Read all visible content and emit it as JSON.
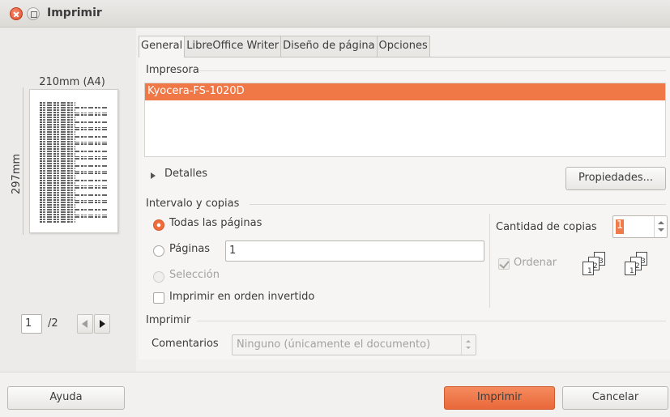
{
  "window": {
    "title": "Imprimir"
  },
  "preview": {
    "width_label": "210mm (A4)",
    "height_label": "297mm",
    "current_page": "1",
    "total_pages": "/2"
  },
  "tabs": [
    {
      "label": "General"
    },
    {
      "label": "LibreOffice Writer"
    },
    {
      "label": "Diseño de página"
    },
    {
      "label": "Opciones"
    }
  ],
  "printer": {
    "section_label": "Impresora",
    "selected": "Kyocera-FS-1020D",
    "details_label": "Detalles",
    "properties_label": "Propiedades..."
  },
  "range": {
    "section_label": "Intervalo y copias",
    "all_pages_label": "Todas las páginas",
    "pages_label": "Páginas",
    "pages_value": "1",
    "selection_label": "Selección",
    "reverse_label": "Imprimir en orden invertido",
    "copies_label": "Cantidad de copias",
    "copies_value": "1",
    "collate_label": "Ordenar"
  },
  "print_section": {
    "section_label": "Imprimir",
    "comments_label": "Comentarios",
    "comments_value": "Ninguno (únicamente el documento)"
  },
  "buttons": {
    "help": "Ayuda",
    "print": "Imprimir",
    "cancel": "Cancelar"
  },
  "colors": {
    "accent": "#f07746",
    "selection": "#f07746"
  }
}
